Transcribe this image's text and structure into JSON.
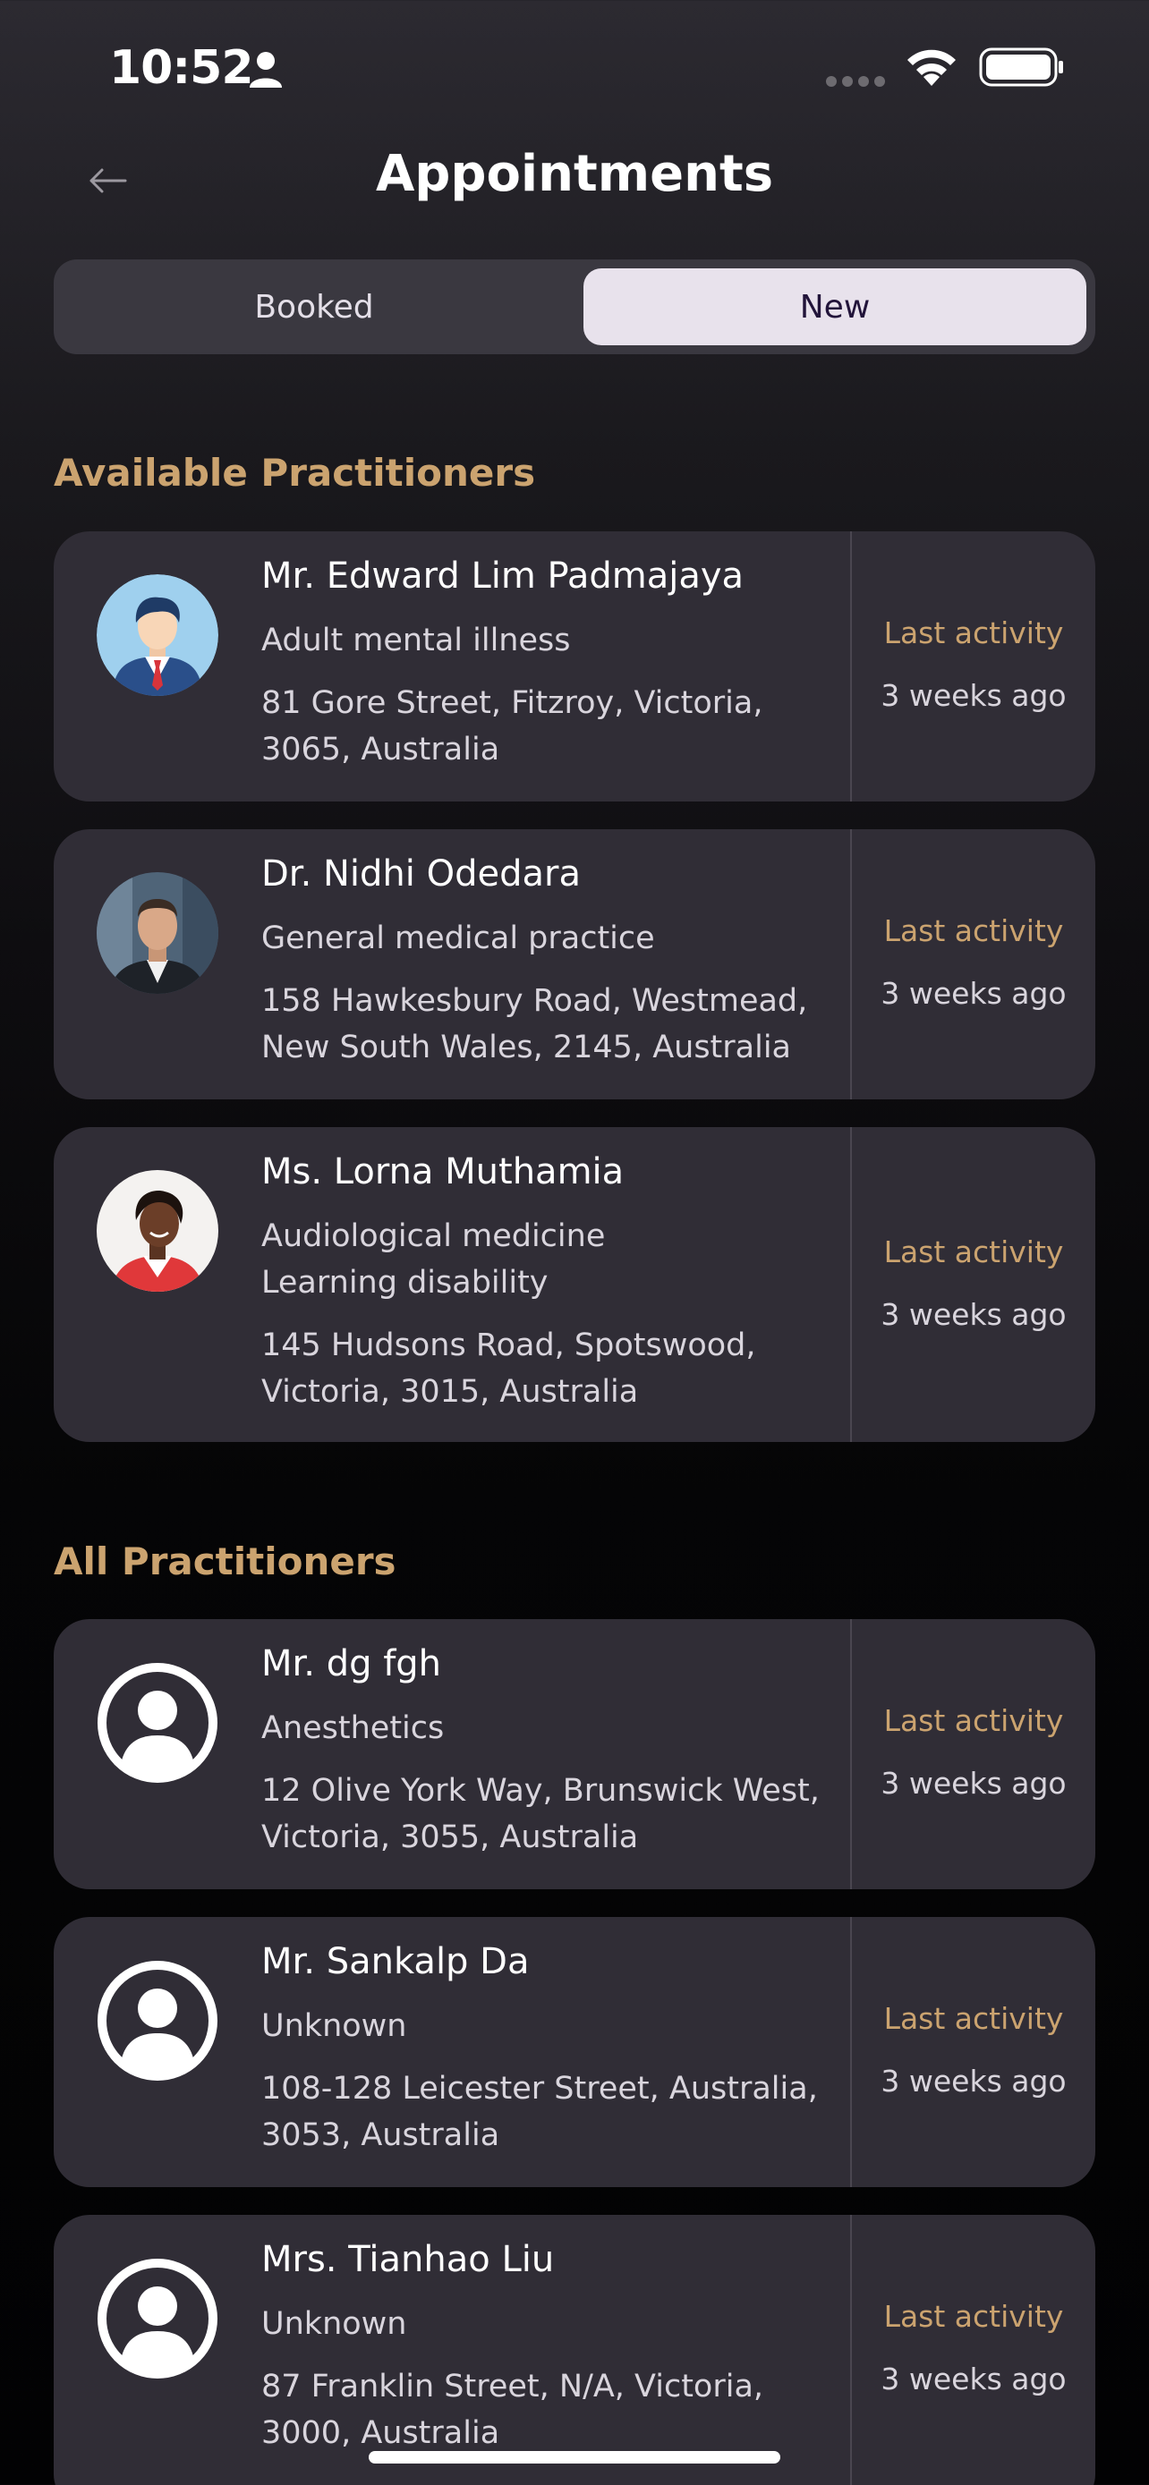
{
  "status_bar": {
    "time": "10:52"
  },
  "header": {
    "title": "Appointments"
  },
  "tabs": [
    {
      "label": "Booked",
      "selected": false
    },
    {
      "label": "New",
      "selected": true
    }
  ],
  "sections": {
    "available": {
      "title": "Available Practitioners",
      "practitioners": [
        {
          "name": "Mr. Edward Lim Padmajaya",
          "specialty": "Adult mental illness",
          "address": "81 Gore Street, Fitzroy, Victoria, 3065, Australia",
          "last_activity_label": "Last activity",
          "last_activity": "3 weeks ago",
          "avatar": "businessman-avatar"
        },
        {
          "name": "Dr. Nidhi Odedara",
          "specialty": "General medical practice",
          "address": "158 Hawkesbury Road, Westmead, New South Wales, 2145, Australia",
          "last_activity_label": "Last activity",
          "last_activity": "3 weeks ago",
          "avatar": "man-photo-avatar"
        },
        {
          "name": "Ms. Lorna Muthamia",
          "specialty": "Audiological medicine\nLearning disability",
          "address": "145 Hudsons Road, Spotswood, Victoria, 3015, Australia",
          "last_activity_label": "Last activity",
          "last_activity": "3 weeks ago",
          "avatar": "woman-photo-avatar"
        }
      ]
    },
    "all": {
      "title": "All Practitioners",
      "practitioners": [
        {
          "name": "Mr. dg fgh",
          "specialty": "Anesthetics",
          "address": "12 Olive York Way, Brunswick West, Victoria, 3055, Australia",
          "last_activity_label": "Last activity",
          "last_activity": "3 weeks ago",
          "avatar": "default-user-icon"
        },
        {
          "name": "Mr. Sankalp Da",
          "specialty": "Unknown",
          "address": "108-128 Leicester Street, Australia, 3053, Australia",
          "last_activity_label": "Last activity",
          "last_activity": "3 weeks ago",
          "avatar": "default-user-icon"
        },
        {
          "name": "Mrs. Tianhao Liu",
          "specialty": "Unknown",
          "address": "87 Franklin Street, N/A, Victoria, 3000, Australia",
          "last_activity_label": "Last activity",
          "last_activity": "3 weeks ago",
          "avatar": "default-user-icon"
        }
      ]
    }
  },
  "colors": {
    "accent": "#cba36f",
    "card": "#302d36",
    "selected_tab": "#e8e2ec"
  }
}
